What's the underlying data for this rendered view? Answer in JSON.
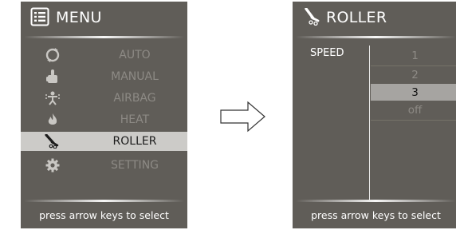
{
  "menu_screen": {
    "title": "MENU",
    "items": [
      {
        "label": "AUTO",
        "icon": "auto-cycle-icon"
      },
      {
        "label": "MANUAL",
        "icon": "hand-icon"
      },
      {
        "label": "AIRBAG",
        "icon": "airbag-icon"
      },
      {
        "label": "HEAT",
        "icon": "flame-icon"
      },
      {
        "label": "ROLLER",
        "icon": "roller-icon",
        "selected": true
      },
      {
        "label": "SETTING",
        "icon": "gear-icon"
      }
    ],
    "footer": "press arrow keys to select"
  },
  "roller_screen": {
    "title": "ROLLER",
    "speed_label": "SPEED",
    "options": [
      "1",
      "2",
      "3",
      "off"
    ],
    "selected_option": "3",
    "footer": "press arrow keys to select"
  },
  "colors": {
    "panel_bg": "#605d58",
    "text_dim": "#8d8a85",
    "highlight": "#cccbc8"
  }
}
